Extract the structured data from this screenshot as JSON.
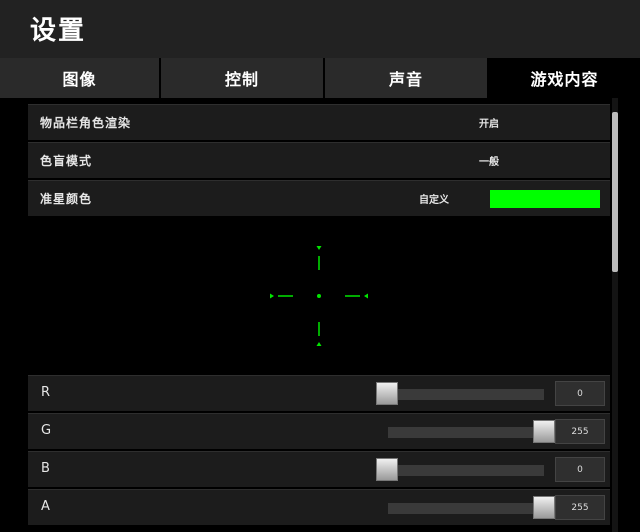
{
  "header": {
    "title": "设置"
  },
  "tabs": [
    {
      "label": "图像"
    },
    {
      "label": "控制"
    },
    {
      "label": "声音"
    },
    {
      "label": "游戏内容"
    }
  ],
  "settings": {
    "inventory_render": {
      "label": "物品栏角色渲染",
      "value": "开启"
    },
    "colorblind_mode": {
      "label": "色盲模式",
      "value": "一般"
    },
    "crosshair_color": {
      "label": "准星颜色",
      "value": "自定义",
      "color": "#00ff00"
    }
  },
  "rgba": [
    {
      "label": "R",
      "value": "0",
      "level": 0
    },
    {
      "label": "G",
      "value": "255",
      "level": 1
    },
    {
      "label": "B",
      "value": "0",
      "level": 0
    },
    {
      "label": "A",
      "value": "255",
      "level": 1
    }
  ],
  "colors": {
    "accent": "#00ff00",
    "background": "#000000",
    "panel": "#1c1c1c"
  }
}
